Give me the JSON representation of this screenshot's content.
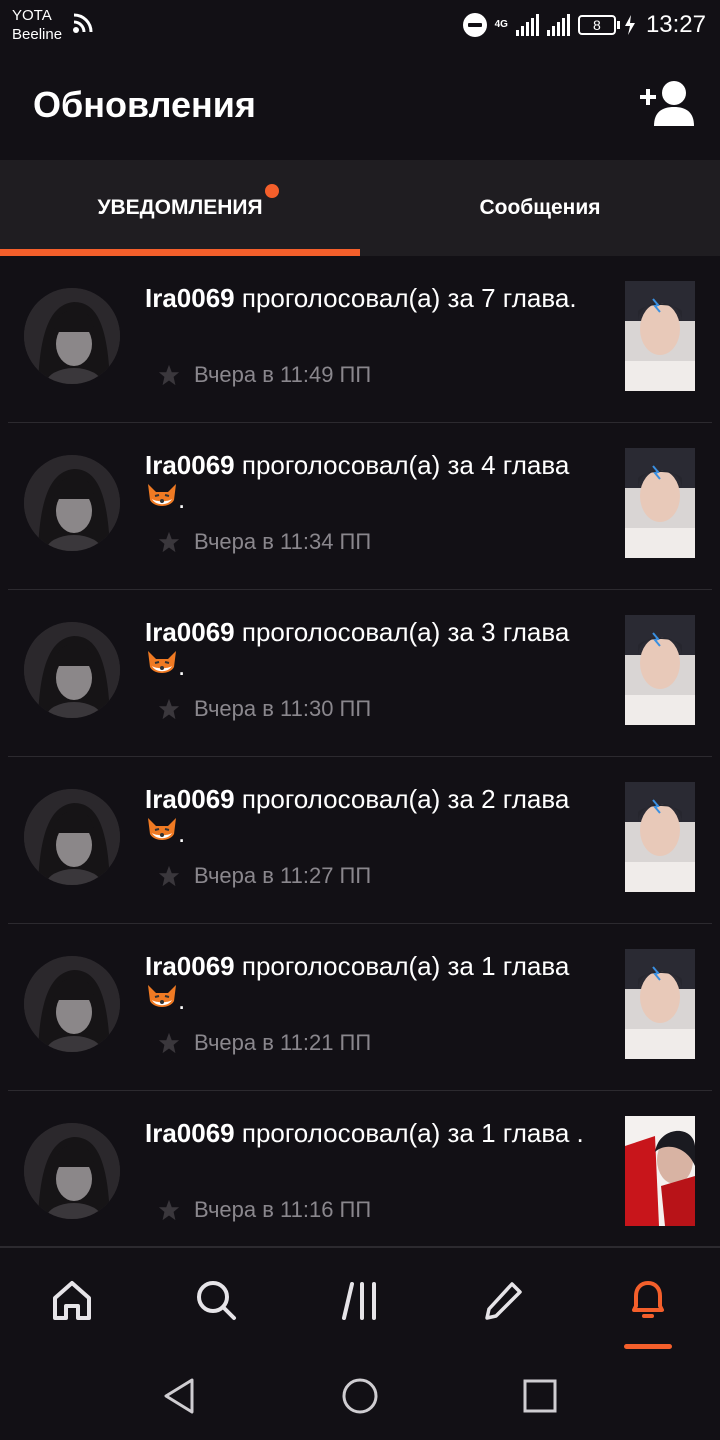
{
  "status_bar": {
    "carrier_line1": "YOTA",
    "carrier_line2": "Beeline",
    "network": "4G",
    "battery": "8",
    "time": "13:27"
  },
  "header": {
    "title": "Обновления",
    "add_user_icon": "add-user-icon"
  },
  "tabs": [
    {
      "label": "УВЕДОМЛЕНИЯ",
      "active": true,
      "has_badge": true
    },
    {
      "label": "Сообщения",
      "active": false,
      "has_badge": false
    }
  ],
  "notifications": [
    {
      "user": "Ira0069",
      "text": " проголосовал(а) за 7 глава.",
      "time": "Вчера в 11:49 ПП"
    },
    {
      "user": "Ira0069",
      "text": " проголосовал(а) за 4 глава",
      "suffix": ".",
      "time": "Вчера в 11:34 ПП"
    },
    {
      "user": "Ira0069",
      "text": " проголосовал(а) за 3 глава",
      "suffix": ".",
      "time": "Вчера в 11:30 ПП"
    },
    {
      "user": "Ira0069",
      "text": " проголосовал(а) за 2 глава",
      "suffix": ".",
      "time": "Вчера в 11:27 ПП"
    },
    {
      "user": "Ira0069",
      "text": " проголосовал(а) за 1 глава",
      "suffix": ".",
      "time": "Вчера в 11:21 ПП"
    },
    {
      "user": "Ira0069",
      "text": " проголосовал(а) за 1 глава .",
      "time": "Вчера в 11:16 ПП"
    }
  ],
  "bottom_nav": [
    {
      "name": "home-icon",
      "active": false
    },
    {
      "name": "search-icon",
      "active": false
    },
    {
      "name": "library-icon",
      "active": false
    },
    {
      "name": "write-icon",
      "active": false
    },
    {
      "name": "bell-icon",
      "active": true
    }
  ],
  "colors": {
    "accent": "#f45f2b",
    "background": "#121015",
    "tab_bar": "#1f1d21",
    "muted_text": "#8a878d"
  }
}
